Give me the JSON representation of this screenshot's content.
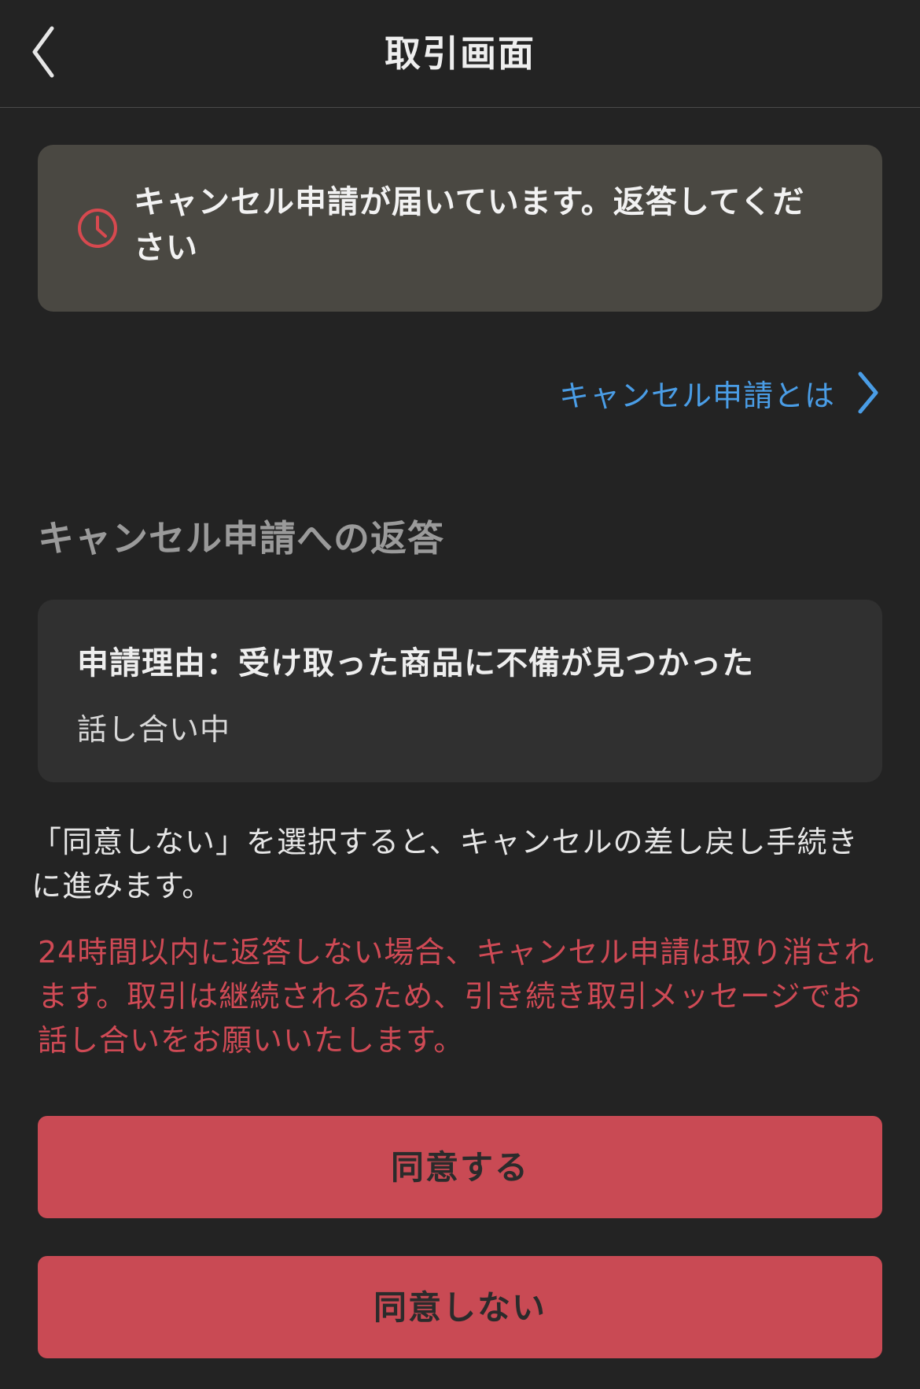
{
  "header": {
    "title": "取引画面",
    "back_icon": "chevron-left-icon"
  },
  "notice": {
    "icon": "clock-icon",
    "text": "キャンセル申請が届いています。返答してください"
  },
  "help_link": {
    "label": "キャンセル申請とは",
    "icon": "chevron-right-icon"
  },
  "section": {
    "title": "キャンセル申請への返答"
  },
  "reason_card": {
    "reason": "申請理由：受け取った商品に不備が見つかった",
    "status": "話し合い中"
  },
  "info": {
    "text": "「同意しない」を選択すると、キャンセルの差し戻し手続きに進みます。"
  },
  "warning": {
    "text": "24時間以内に返答しない場合、キャンセル申請は取り消されます。取引は継続されるため、引き続き取引メッセージでお話し合いをお願いいたします。"
  },
  "actions": {
    "agree_label": "同意する",
    "disagree_label": "同意しない"
  },
  "colors": {
    "background": "#232323",
    "notice_background": "#4a4842",
    "card_background": "#303030",
    "link": "#4a9de6",
    "warning": "#cf4a55",
    "button": "#c94a54"
  }
}
